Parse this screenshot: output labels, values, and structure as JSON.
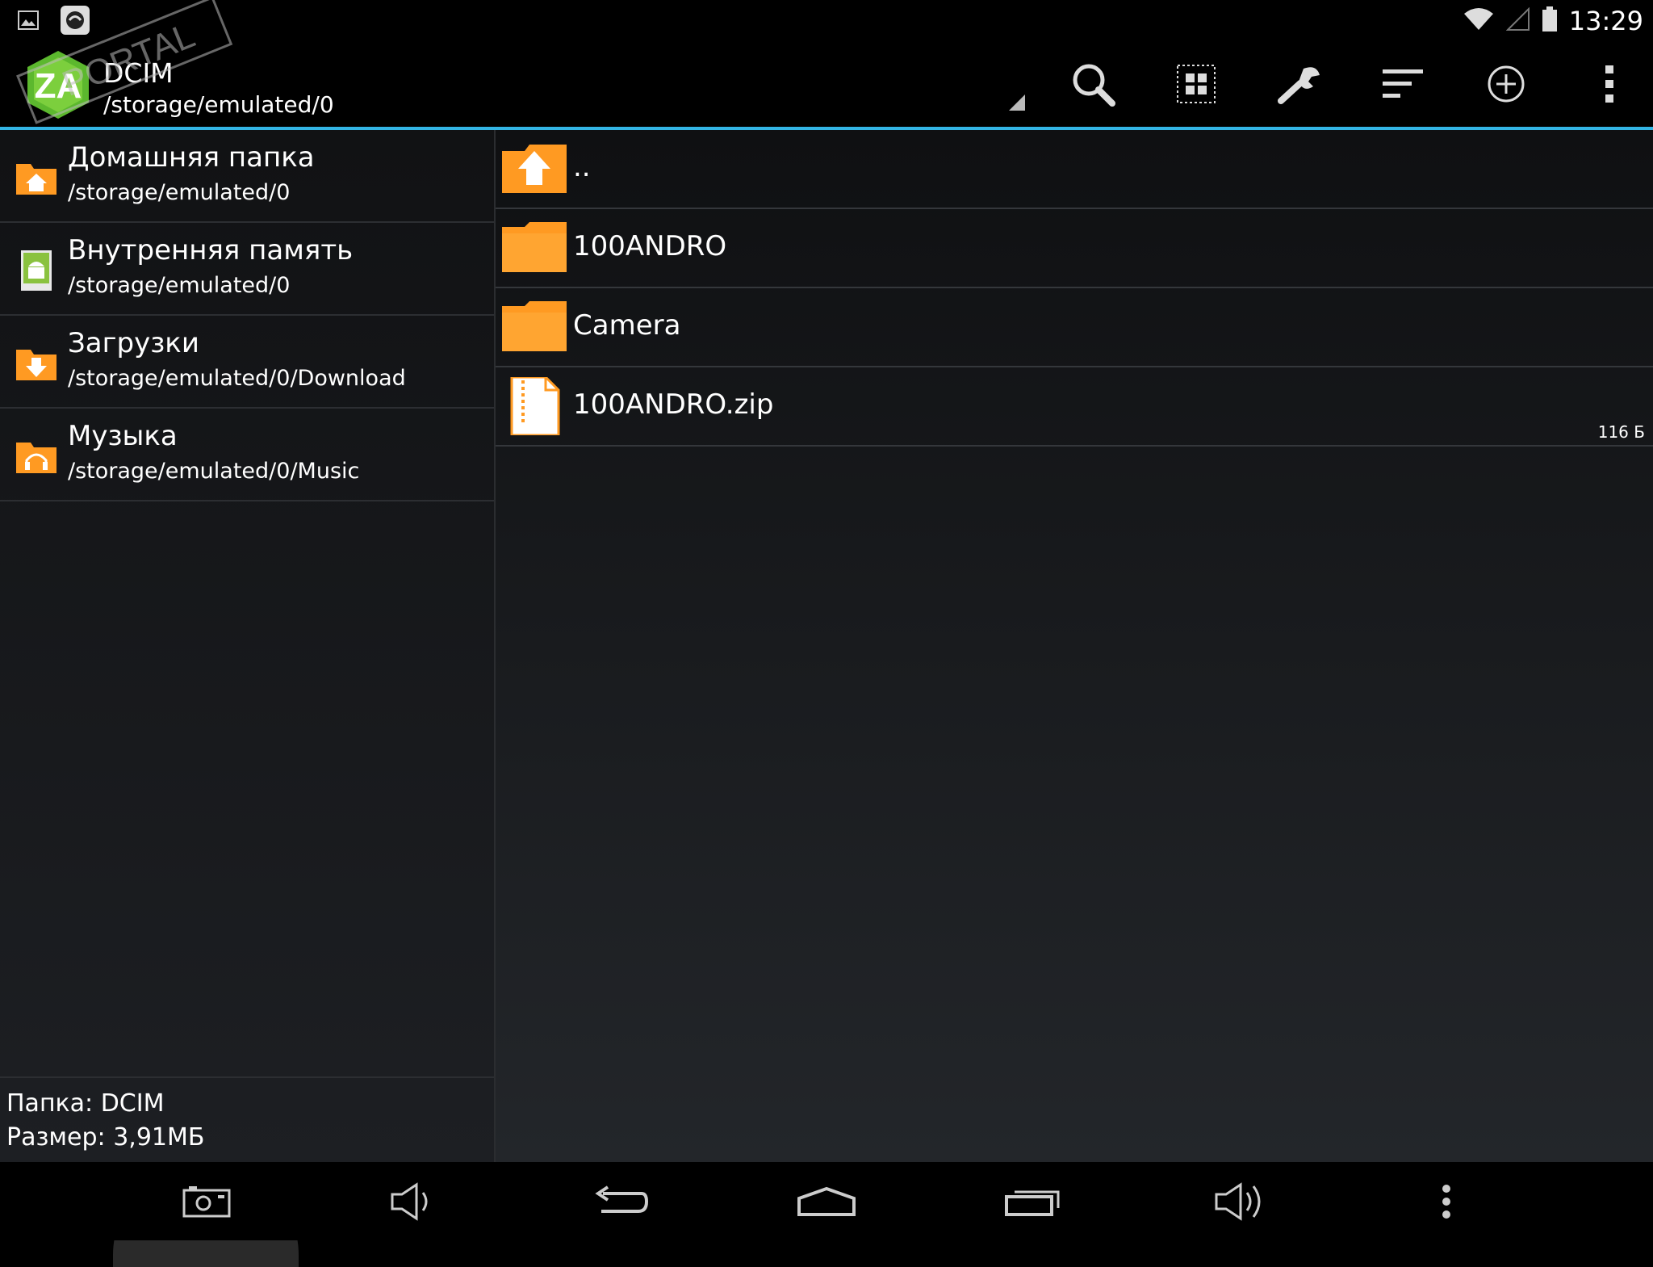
{
  "status_bar": {
    "time": "13:29",
    "icons": [
      "image-notification-icon",
      "app-notification-icon",
      "wifi-icon",
      "signal-icon",
      "battery-icon"
    ]
  },
  "action_bar": {
    "title": "DCIM",
    "path": "/storage/emulated/0",
    "watermark": "PORTAL",
    "actions": [
      "search-icon",
      "multiselect-icon",
      "tools-icon",
      "sort-icon",
      "add-icon",
      "overflow-menu-icon"
    ],
    "accent_color": "#33b5e5"
  },
  "bookmarks": [
    {
      "label": "Домашняя папка",
      "path": "/storage/emulated/0",
      "icon": "home-folder-icon"
    },
    {
      "label": "Внутренняя память",
      "path": "/storage/emulated/0",
      "icon": "android-storage-icon"
    },
    {
      "label": "Загрузки",
      "path": "/storage/emulated/0/Download",
      "icon": "download-folder-icon"
    },
    {
      "label": "Музыка",
      "path": "/storage/emulated/0/Music",
      "icon": "music-folder-icon"
    }
  ],
  "footer": {
    "folder_line": "Папка: DCIM",
    "size_line": "Размер: 3,91МБ"
  },
  "files": [
    {
      "name": "..",
      "type": "up",
      "size": ""
    },
    {
      "name": "100ANDRO",
      "type": "folder",
      "size": ""
    },
    {
      "name": "Camera",
      "type": "folder",
      "size": ""
    },
    {
      "name": "100ANDRO.zip",
      "type": "zip",
      "size": "116 Б"
    }
  ],
  "nav_bar": [
    "screenshot-icon",
    "volume-down-icon",
    "back-icon",
    "home-icon",
    "recents-icon",
    "volume-up-icon",
    "menu-icon"
  ],
  "colors": {
    "folder_orange": "#ff9a22",
    "accent_blue": "#33b5e5"
  }
}
